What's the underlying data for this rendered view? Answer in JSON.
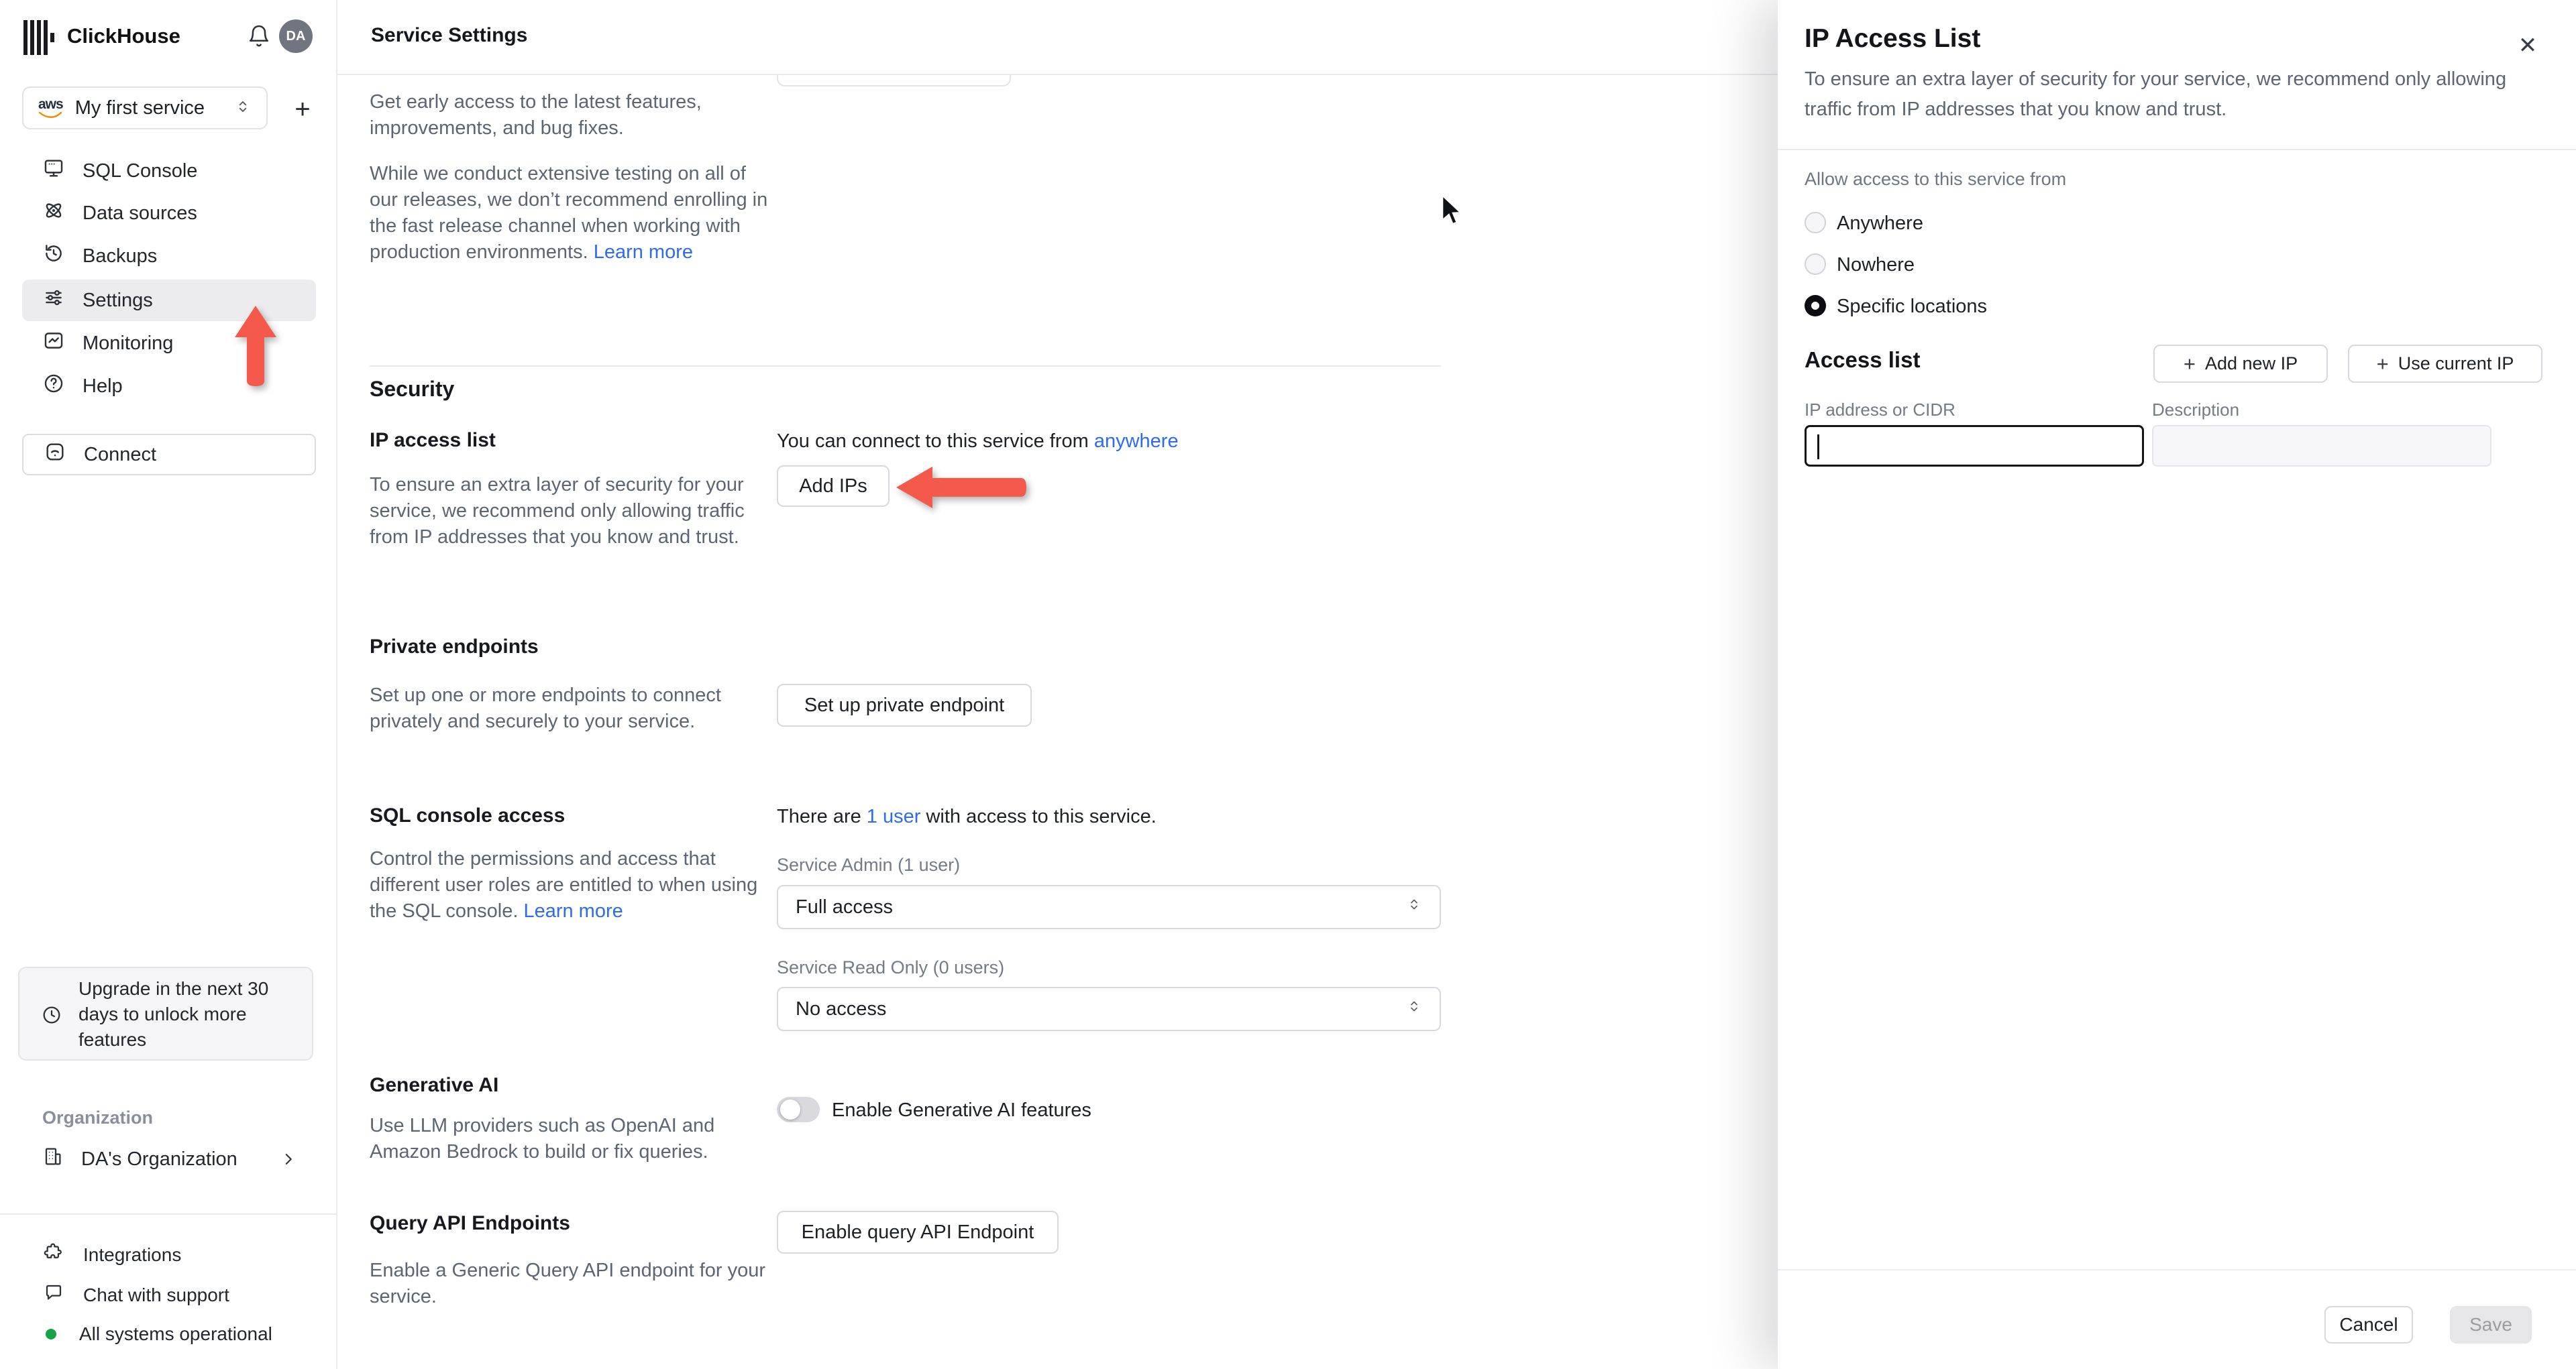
{
  "colors": {
    "accent_red": "#f4594b",
    "link_blue": "#2f6bf0",
    "status_green": "#18a34a",
    "active_item_bg": "#ececee"
  },
  "icons": {
    "plus": "+",
    "close": "✕"
  },
  "topbar": {
    "brand": "ClickHouse",
    "avatar_initials": "DA"
  },
  "sidebar": {
    "service_selector": {
      "provider": "aws",
      "label": "My first service"
    },
    "nav": [
      {
        "label": "SQL Console"
      },
      {
        "label": "Data sources"
      },
      {
        "label": "Backups"
      },
      {
        "label": "Settings",
        "active": true
      },
      {
        "label": "Monitoring"
      },
      {
        "label": "Help"
      }
    ],
    "connect_label": "Connect",
    "upgrade_notice": "Upgrade in the next 30 days to unlock more features",
    "organization_section_label": "Organization",
    "organization_name": "DA's Organization",
    "footer": {
      "integrations": "Integrations",
      "chat": "Chat with support",
      "status": "All systems operational"
    }
  },
  "header": {
    "title": "Service Settings"
  },
  "main": {
    "fast_release": {
      "p1": "Get early access to the latest features, improvements, and bug fixes.",
      "p2": "While we conduct extensive testing on all of our releases, we don’t recommend enrolling in the fast release channel when working with production environments. ",
      "learn_more": "Learn more"
    },
    "security": {
      "title": "Security",
      "ip_access": {
        "title": "IP access list",
        "connect_prefix": "You can connect to this service from ",
        "connect_link": "anywhere",
        "button": "Add IPs",
        "description": "To ensure an extra layer of security for your service, we recommend only allowing traffic from IP addresses that you know and trust."
      },
      "private_endpoints": {
        "title": "Private endpoints",
        "description": "Set up one or more endpoints to connect privately and securely to your service.",
        "button": "Set up private endpoint"
      },
      "sql_console_access": {
        "title": "SQL console access",
        "users_prefix": "There are ",
        "users_link": "1 user",
        "users_suffix": " with access to this service.",
        "description": "Control the permissions and access that different user roles are entitled to when using the SQL console. ",
        "learn_more": "Learn more",
        "admin_label": "Service Admin (1 user)",
        "admin_value": "Full access",
        "readonly_label": "Service Read Only (0 users)",
        "readonly_value": "No access"
      },
      "generative_ai": {
        "title": "Generative AI",
        "toggle_label": "Enable Generative AI features",
        "toggle_on": false,
        "description": "Use LLM providers such as OpenAI and Amazon Bedrock to build or fix queries."
      },
      "query_api": {
        "title": "Query API Endpoints",
        "button": "Enable query API Endpoint",
        "description": "Enable a Generic Query API endpoint for your service."
      }
    }
  },
  "panel": {
    "title": "IP Access List",
    "description": "To ensure an extra layer of security for your service, we recommend only allowing traffic from IP addresses that you know and trust.",
    "allow_label": "Allow access to this service from",
    "options": [
      {
        "label": "Anywhere",
        "selected": false
      },
      {
        "label": "Nowhere",
        "selected": false
      },
      {
        "label": "Specific locations",
        "selected": true
      }
    ],
    "access_list_title": "Access list",
    "add_new_ip": "Add new IP",
    "use_current_ip": "Use current IP",
    "ip_label": "IP address or CIDR",
    "description_label": "Description",
    "ip_value": "",
    "description_value": "",
    "cancel": "Cancel",
    "save": "Save"
  }
}
